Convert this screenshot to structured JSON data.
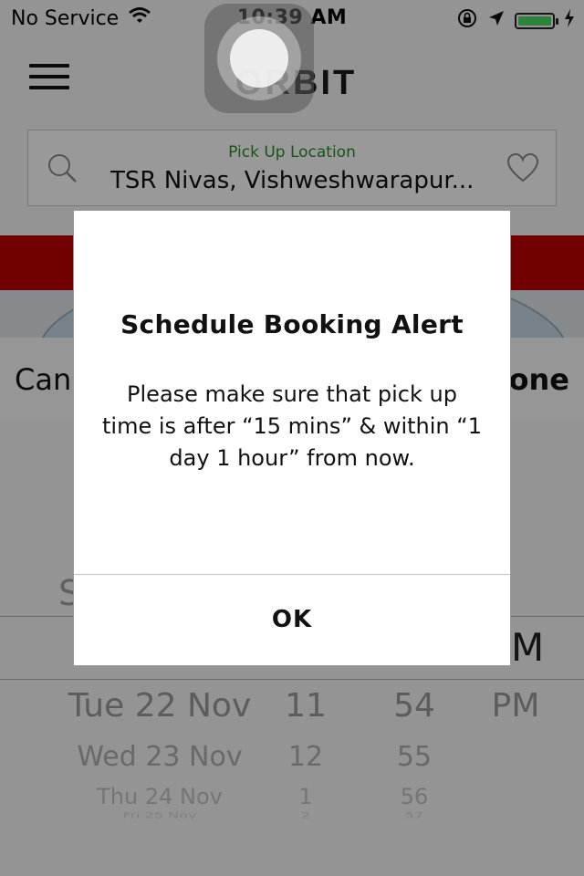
{
  "status_bar": {
    "carrier": "No Service",
    "time": "10:39 AM",
    "battery_level": 1.0,
    "battery_color": "#4cd964"
  },
  "header": {
    "logo": "ORBIT"
  },
  "location": {
    "label": "Pick Up Location",
    "value": "TSR Nivas, Vishweshwarapur...",
    "label_color": "#2b8a2b"
  },
  "picker_toolbar": {
    "cancel_label": "Cancel",
    "done_label": "Done"
  },
  "picker": {
    "hidden_top_left": "S",
    "hidden_top_right": "M",
    "rows": [
      {
        "day": "Tue 22 Nov",
        "hour": "11",
        "minute": "54",
        "ampm": "PM"
      },
      {
        "day": "Wed 23 Nov",
        "hour": "12",
        "minute": "55",
        "ampm": ""
      },
      {
        "day": "Thu 24 Nov",
        "hour": "1",
        "minute": "56",
        "ampm": ""
      },
      {
        "day": "Fri 25 Nov",
        "hour": "2",
        "minute": "57",
        "ampm": ""
      }
    ]
  },
  "dialog": {
    "title": "Schedule Booking Alert",
    "message": "Please make sure that pick up\ntime is after “15 mins” & within “1\nday 1 hour” from now.",
    "ok_label": "OK"
  },
  "colors": {
    "brand_red": "#c00000"
  }
}
